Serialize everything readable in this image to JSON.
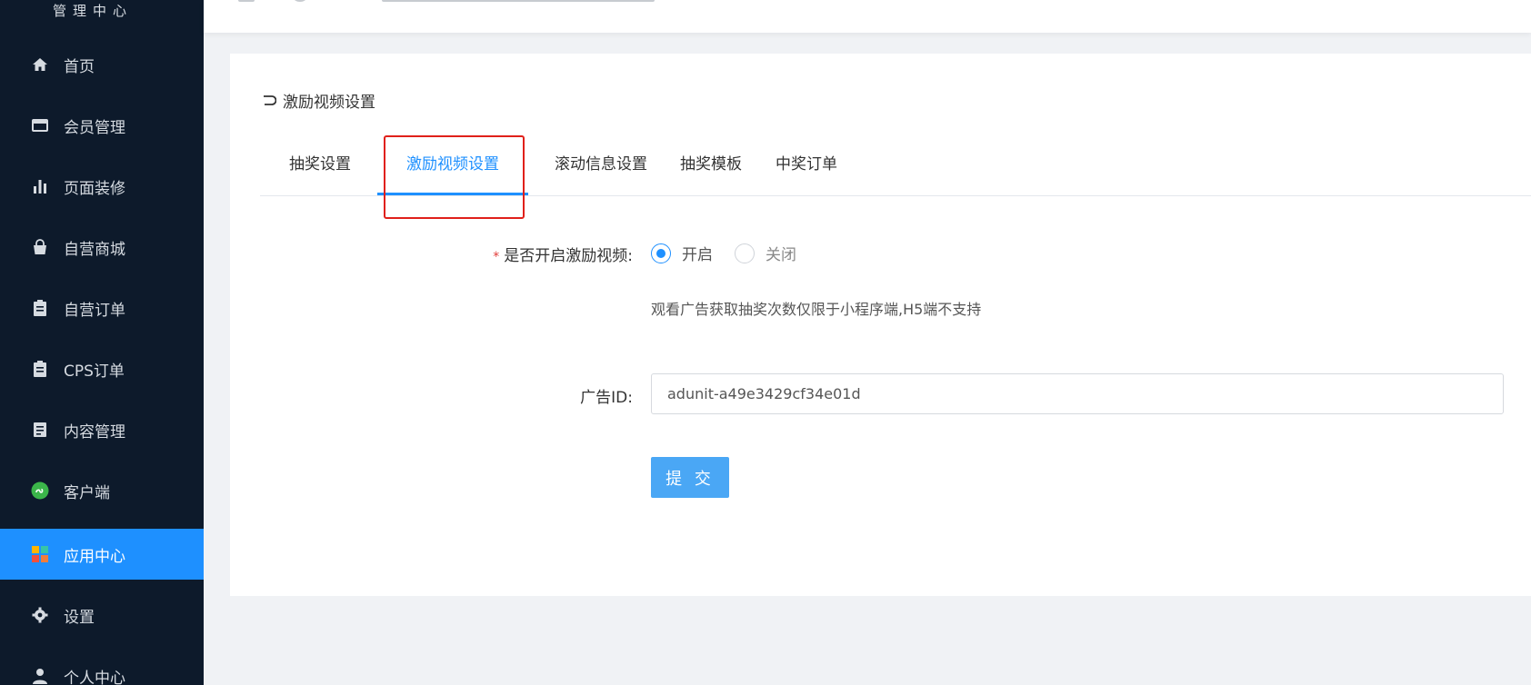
{
  "sidebar": {
    "title": "管理中心",
    "items": [
      {
        "label": "首页",
        "icon": "home-icon"
      },
      {
        "label": "会员管理",
        "icon": "store-icon"
      },
      {
        "label": "页面装修",
        "icon": "bar-chart-icon"
      },
      {
        "label": "自营商城",
        "icon": "shopping-bag-icon"
      },
      {
        "label": "自营订单",
        "icon": "clipboard-icon"
      },
      {
        "label": "CPS订单",
        "icon": "clipboard-icon"
      },
      {
        "label": "内容管理",
        "icon": "document-icon"
      },
      {
        "label": "客户端",
        "icon": "mini-program-icon"
      },
      {
        "label": "应用中心",
        "icon": "apps-icon",
        "active": true
      },
      {
        "label": "设置",
        "icon": "gear-icon"
      },
      {
        "label": "个人中心",
        "icon": "user-icon"
      }
    ]
  },
  "page": {
    "back_label": "激励视频设置"
  },
  "tabs": [
    {
      "label": "抽奖设置"
    },
    {
      "label": "激励视频设置",
      "active": true
    },
    {
      "label": "滚动信息设置"
    },
    {
      "label": "抽奖模板"
    },
    {
      "label": "中奖订单"
    }
  ],
  "form": {
    "enable_label": "是否开启激励视频:",
    "required_mark": "*",
    "options": [
      {
        "label": "开启",
        "checked": true
      },
      {
        "label": "关闭",
        "checked": false
      }
    ],
    "hint": "观看广告获取抽奖次数仅限于小程序端,H5端不支持",
    "ad_id_label": "广告ID:",
    "ad_id_value": "adunit-a49e3429cf34e01d",
    "submit_label": "提 交"
  },
  "colors": {
    "sidebar_bg": "#0d1a2b",
    "accent": "#1e90ff",
    "submit_bg": "#4aa7f5",
    "highlight": "#e0201a"
  }
}
